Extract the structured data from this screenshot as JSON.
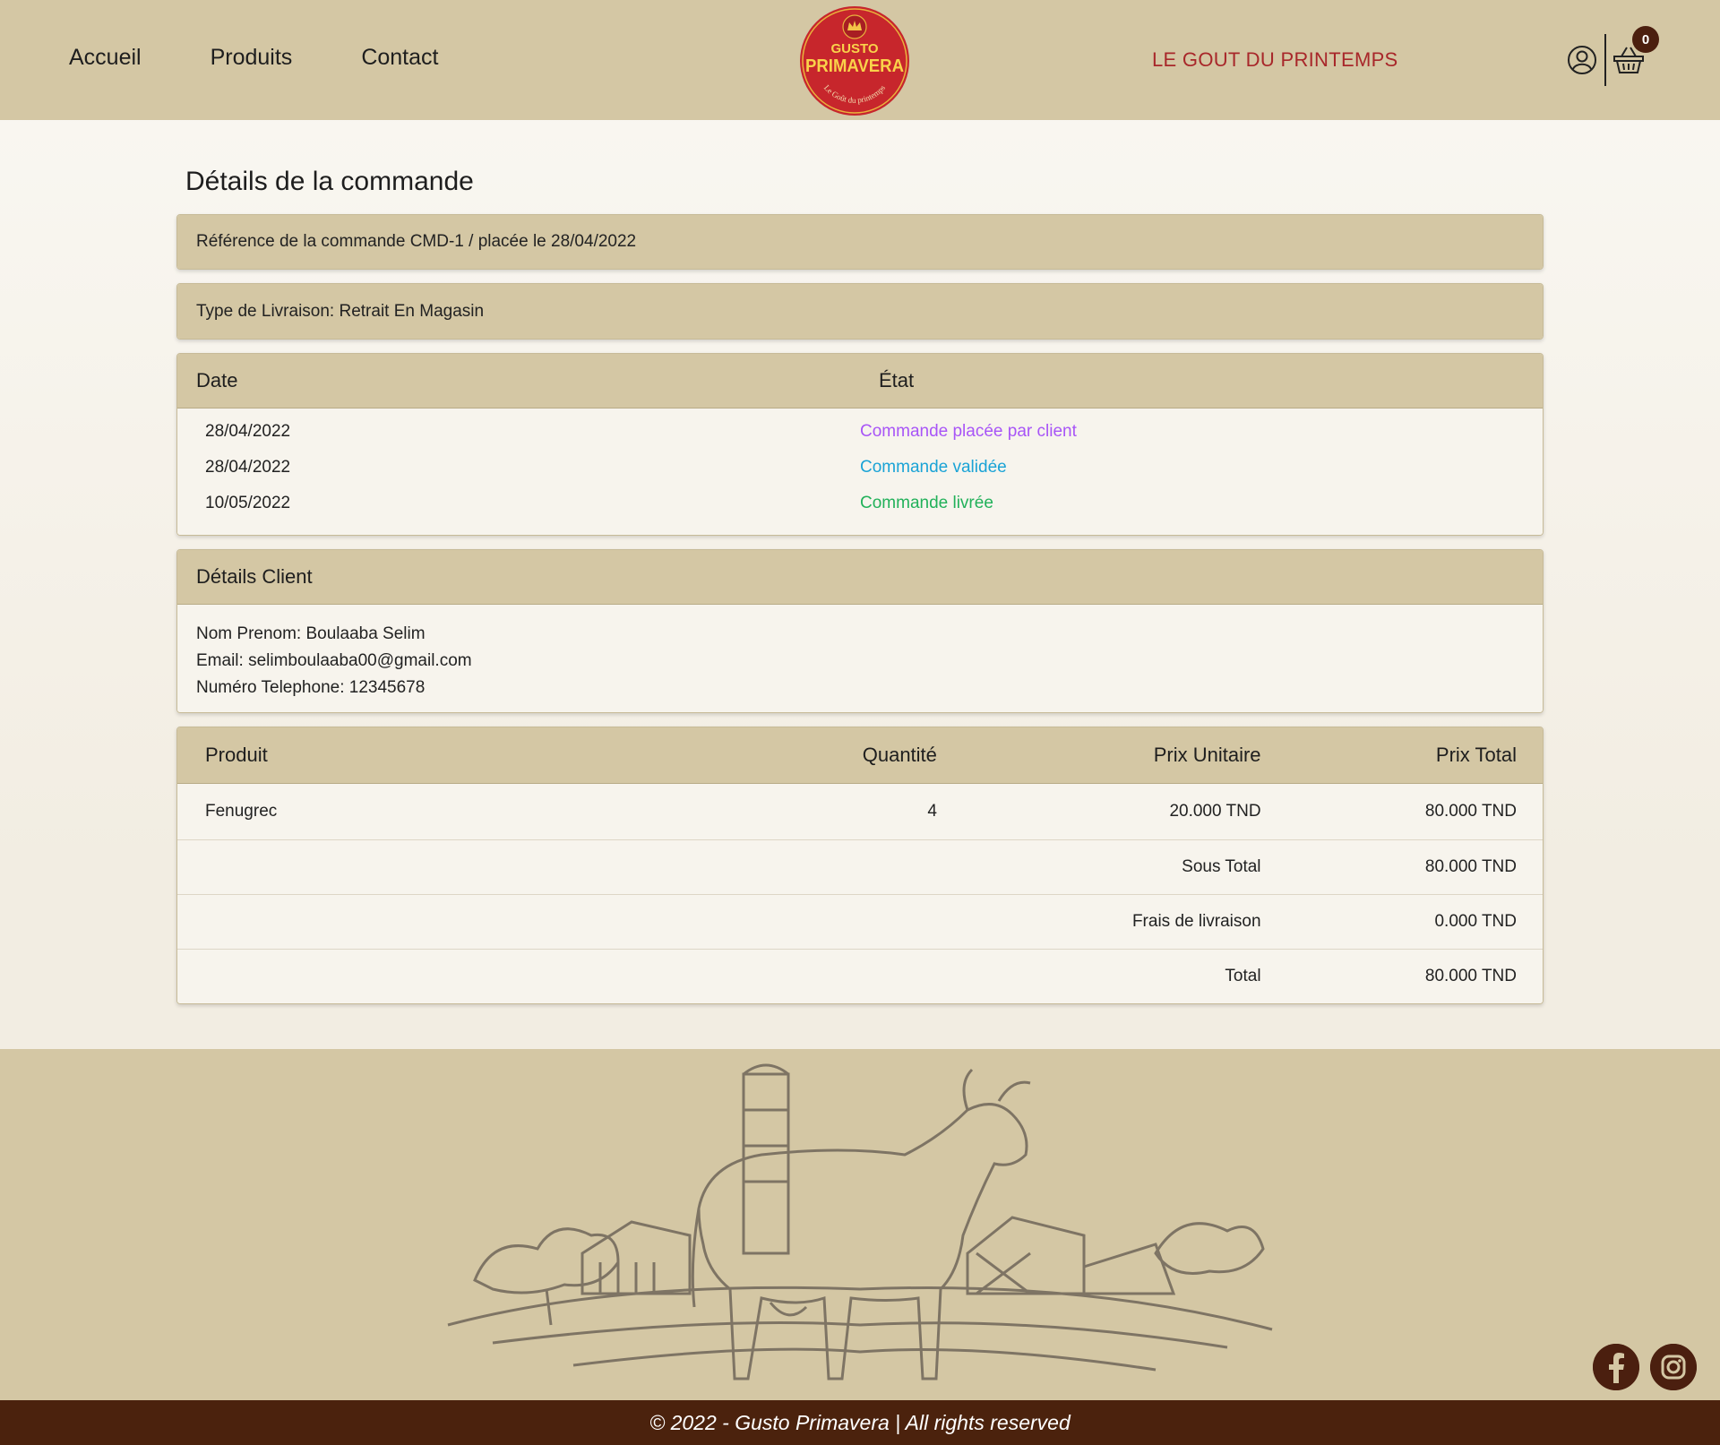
{
  "nav": {
    "items": [
      {
        "label": "Accueil"
      },
      {
        "label": "Produits"
      },
      {
        "label": "Contact"
      }
    ]
  },
  "logo": {
    "top": "GUSTO",
    "main": "PRIMAVERA",
    "arc": "Le Goût du printemps"
  },
  "tagline": "LE GOUT DU PRINTEMPS",
  "icons": {
    "user": "user-circle-icon",
    "cart": "basket-icon"
  },
  "cart": {
    "count": "0"
  },
  "page": {
    "title": "Détails de la commande"
  },
  "order": {
    "reference": "Référence de la commande CMD-1 / placée le 28/04/2022",
    "delivery": "Type de Livraison: Retrait En Magasin"
  },
  "history": {
    "headers": {
      "date": "Date",
      "state": "État"
    },
    "rows": [
      {
        "date": "28/04/2022",
        "state": "Commande placée par client",
        "color": "#a855f7"
      },
      {
        "date": "28/04/2022",
        "state": "Commande validée",
        "color": "#1aa3d6"
      },
      {
        "date": "10/05/2022",
        "state": "Commande livrée",
        "color": "#22b15a"
      }
    ]
  },
  "client": {
    "title": "Détails Client",
    "name": "Nom Prenom: Boulaaba Selim",
    "email": "Email: selimboulaaba00@gmail.com",
    "phone": "Numéro Telephone: 12345678"
  },
  "products": {
    "headers": {
      "product": "Produit",
      "qty": "Quantité",
      "unit": "Prix Unitaire",
      "total": "Prix Total"
    },
    "items": [
      {
        "product": "Fenugrec",
        "qty": "4",
        "unit": "20.000 TND",
        "total": "80.000 TND"
      }
    ],
    "summary": [
      {
        "label": "Sous Total",
        "value": "80.000 TND"
      },
      {
        "label": "Frais de livraison",
        "value": "0.000 TND"
      },
      {
        "label": "Total",
        "value": "80.000 TND"
      }
    ]
  },
  "social": {
    "facebook": "facebook-icon",
    "instagram": "instagram-icon"
  },
  "footer": {
    "copyright": "© 2022 - Gusto Primavera | All rights reserved"
  },
  "colors": {
    "header_bg": "#d4c7a4",
    "accent_red": "#a8272a",
    "footer_dark": "#4b220d"
  }
}
